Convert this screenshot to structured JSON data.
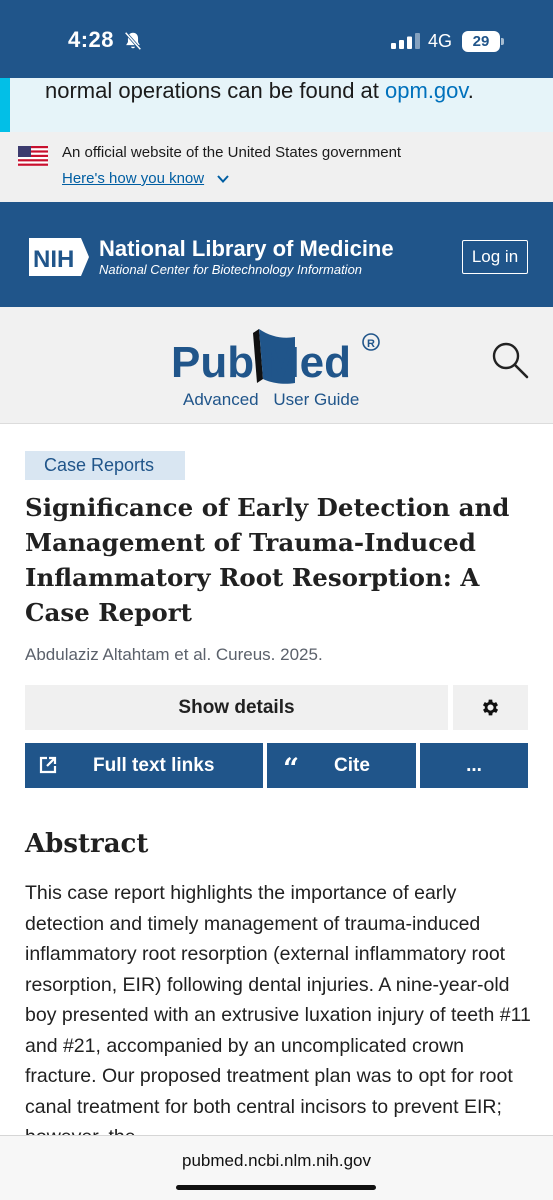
{
  "status": {
    "time": "4:28",
    "network": "4G",
    "battery": "29"
  },
  "alert": {
    "text": "normal operations can be found at ",
    "link": "opm.gov",
    "suffix": "."
  },
  "gov_banner": {
    "text": "An official website of the United States government",
    "link": "Here's how you know"
  },
  "nih": {
    "logo": "NIH",
    "title": "National Library of Medicine",
    "subtitle": "National Center for Biotechnology Information",
    "login": "Log in"
  },
  "pubmed": {
    "links": [
      "Advanced",
      "User Guide"
    ]
  },
  "article": {
    "tag": "Case Reports",
    "title": "Significance of Early Detection and Management of Trauma-Induced Inflammatory Root Resorption: A Case Report",
    "authors": "Abdulaziz Altahtam et al. Cureus. 2025.",
    "show_details": "Show details",
    "full_text": "Full text links",
    "cite_glyph": "“",
    "cite": "Cite",
    "more": "...",
    "abstract_heading": "Abstract",
    "abstract": "This case report highlights the importance of early detection and timely management of trauma-induced inflammatory root resorption (external inflammatory root resorption, EIR) following dental injuries. A nine-year-old boy presented with an extrusive luxation injury of teeth #11 and #21, accompanied by an uncomplicated crown fracture. Our proposed treatment plan was to opt for root canal treatment for both central incisors to prevent EIR; however, the"
  },
  "browser": {
    "url": "pubmed.ncbi.nlm.nih.gov"
  },
  "colors": {
    "nih_blue": "#20558a",
    "link_blue": "#0071bc",
    "alert_accent": "#02bfe7"
  }
}
